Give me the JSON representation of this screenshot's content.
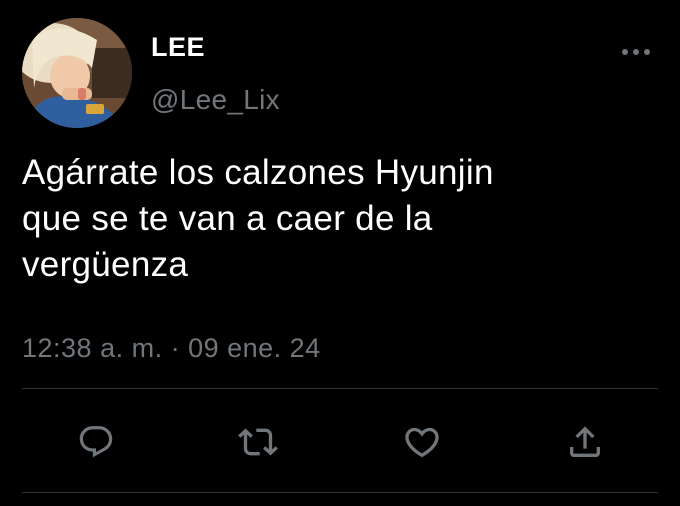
{
  "tweet": {
    "display_name": "LEE",
    "handle": "@Lee_Lix",
    "text_lines": [
      "Agárrate los calzones Hyunjin",
      "que se te van a caer de la",
      "vergüenza"
    ],
    "timestamp": "12:38 a. m. · 09 ene. 24"
  },
  "icons": {
    "more": "more-horizontal-icon",
    "reply": "reply-icon",
    "retweet": "retweet-icon",
    "like": "heart-icon",
    "share": "share-icon"
  },
  "colors": {
    "background": "#000000",
    "text": "#ffffff",
    "secondary_text": "#71767b",
    "divider": "#2f3336",
    "icon": "#71767b"
  }
}
